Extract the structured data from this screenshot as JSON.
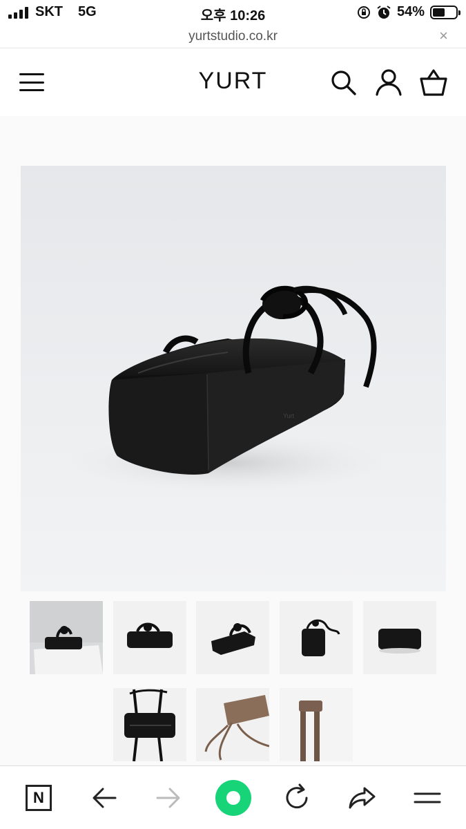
{
  "status": {
    "carrier": "SKT",
    "network": "5G",
    "time": "오후 10:26",
    "battery": "54%",
    "battery_level": 0.54
  },
  "browser": {
    "url": "yurtstudio.co.kr",
    "close_label": "×"
  },
  "header": {
    "logo": "YURT",
    "icons": [
      "menu-icon",
      "search-icon",
      "user-icon",
      "cart-icon"
    ]
  },
  "product": {
    "bag_stamp": "Yurt",
    "thumbnails": [
      {
        "label": "bag-on-pedestal",
        "selected": true
      },
      {
        "label": "bag-top-view"
      },
      {
        "label": "bag-angle-view"
      },
      {
        "label": "bag-end-view"
      },
      {
        "label": "bag-front-view"
      },
      {
        "label": "bag-straps-top"
      },
      {
        "label": "bag-brown-strap"
      },
      {
        "label": "strap-detail"
      }
    ]
  },
  "browser_nav": {
    "home_letter": "N",
    "icons": [
      "naver-home-icon",
      "back-arrow-icon",
      "forward-arrow-icon",
      "green-dot-icon",
      "reload-icon",
      "share-icon",
      "menu-lines-icon"
    ]
  }
}
